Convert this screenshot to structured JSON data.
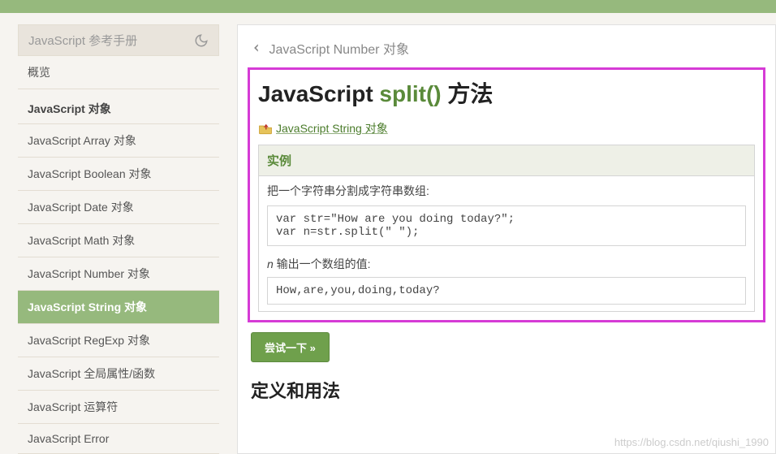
{
  "sidebar": {
    "title": "JavaScript 参考手册",
    "overview": "概览",
    "heading": "JavaScript 对象",
    "items": [
      "JavaScript Array 对象",
      "JavaScript Boolean 对象",
      "JavaScript Date 对象",
      "JavaScript Math 对象",
      "JavaScript Number 对象",
      "JavaScript String 对象",
      "JavaScript RegExp 对象",
      "JavaScript 全局属性/函数",
      "JavaScript 运算符",
      "JavaScript Error"
    ],
    "active_index": 5
  },
  "breadcrumb": {
    "back_label": "JavaScript Number 对象"
  },
  "page": {
    "title_plain_a": "JavaScript ",
    "title_green": "split()",
    "title_plain_b": " 方法",
    "parent_link": " JavaScript String 对象"
  },
  "example": {
    "header": "实例",
    "desc": "把一个字符串分割成字符串数组:",
    "code": "var str=\"How are you doing today?\";\nvar n=str.split(\" \");",
    "output_label_italic": "n",
    "output_label_rest": " 输出一个数组的值:",
    "output": "How,are,you,doing,today?"
  },
  "buttons": {
    "try_it": "尝试一下 »"
  },
  "section_cut": "定义和用法",
  "watermark": "https://blog.csdn.net/qiushi_1990"
}
